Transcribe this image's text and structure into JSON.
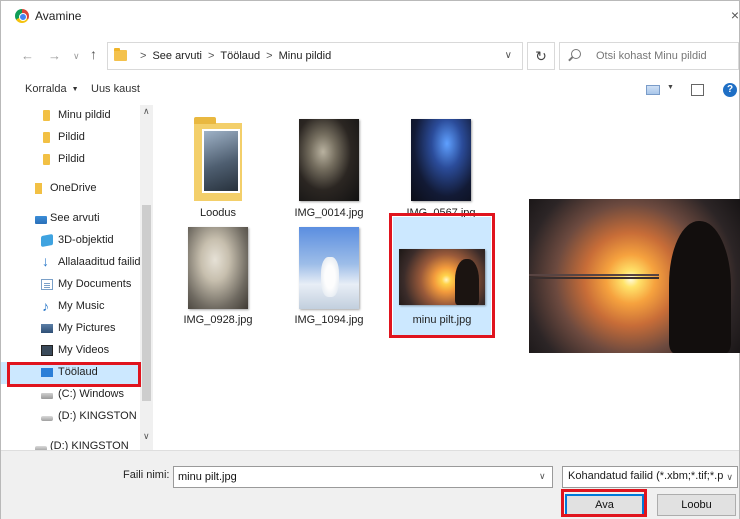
{
  "window": {
    "title": "Avamine",
    "close_glyph": "×"
  },
  "address": {
    "crumbs": [
      "See arvuti",
      "Töölaud",
      "Minu pildid"
    ],
    "separator": ">",
    "search_placeholder": "Otsi kohast Minu pildid"
  },
  "toolbar": {
    "organize_label": "Korralda",
    "new_folder_label": "Uus kaust"
  },
  "nav": {
    "items": [
      {
        "label": "Minu pildid",
        "icon": "folder-icon"
      },
      {
        "label": "Pildid",
        "icon": "folder-icon"
      },
      {
        "label": "Pildid",
        "icon": "folder-icon"
      },
      {
        "label": "OneDrive",
        "icon": "onedrive-icon"
      },
      {
        "label": "See arvuti",
        "icon": "computer-icon"
      },
      {
        "label": "3D-objektid",
        "icon": "3d-objects-icon"
      },
      {
        "label": "Allalaaditud failid",
        "icon": "download-icon"
      },
      {
        "label": "My Documents",
        "icon": "documents-icon"
      },
      {
        "label": "My Music",
        "icon": "music-icon"
      },
      {
        "label": "My Pictures",
        "icon": "pictures-icon"
      },
      {
        "label": "My Videos",
        "icon": "videos-icon"
      },
      {
        "label": "Töölaud",
        "icon": "desktop-icon",
        "selected": true
      },
      {
        "label": "(C:) Windows",
        "icon": "drive-icon"
      },
      {
        "label": "(D:) KINGSTON",
        "icon": "usb-drive-icon"
      },
      {
        "label": "(D:) KINGSTON",
        "icon": "usb-drive-icon"
      }
    ]
  },
  "files": [
    {
      "name": "Loodus",
      "kind": "folder"
    },
    {
      "name": "IMG_0014.jpg",
      "kind": "image"
    },
    {
      "name": "IMG_0567.jpg",
      "kind": "image"
    },
    {
      "name": "IMG_0928.jpg",
      "kind": "image"
    },
    {
      "name": "IMG_1094.jpg",
      "kind": "image"
    },
    {
      "name": "minu pilt.jpg",
      "kind": "image",
      "selected": true
    }
  ],
  "footer": {
    "filename_label": "Faili nimi:",
    "filename_value": "minu pilt.jpg",
    "filetype_value": "Kohandatud failid (*.xbm;*.tif;*.p",
    "open_label": "Ava",
    "cancel_label": "Loobu"
  },
  "colors": {
    "highlight": "#e0141e",
    "selection": "#cce8ff",
    "accent": "#0078d7"
  }
}
